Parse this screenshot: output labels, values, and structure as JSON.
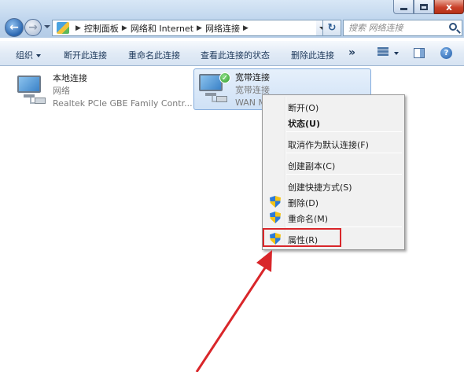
{
  "window": {
    "close_glyph": "x"
  },
  "address_bar": {
    "crumbs": [
      "控制面板",
      "网络和 Internet",
      "网络连接"
    ]
  },
  "search": {
    "placeholder": "搜索 网络连接"
  },
  "toolbar": {
    "organize": "组织",
    "disable": "断开此连接",
    "rename": "重命名此连接",
    "view_status": "查看此连接的状态",
    "delete": "删除此连接",
    "more": "»",
    "help": "?"
  },
  "connections": [
    {
      "name": "本地连接",
      "status": "网络",
      "device": "Realtek PCIe GBE Family Contr..."
    },
    {
      "name": "宽带连接",
      "status": "宽带连接",
      "device": "WAN M"
    }
  ],
  "context_menu": {
    "items": [
      {
        "label": "断开(O)",
        "bold": false,
        "shield": false
      },
      {
        "label": "状态(U)",
        "bold": true,
        "shield": false
      },
      {
        "label": "取消作为默认连接(F)",
        "bold": false,
        "shield": false
      },
      {
        "label": "创建副本(C)",
        "bold": false,
        "shield": false
      },
      {
        "label": "创建快捷方式(S)",
        "bold": false,
        "shield": false
      },
      {
        "label": "删除(D)",
        "bold": false,
        "shield": true
      },
      {
        "label": "重命名(M)",
        "bold": false,
        "shield": true
      },
      {
        "label": "属性(R)",
        "bold": false,
        "shield": true
      }
    ],
    "highlighted_item": "属性(R)"
  },
  "colors": {
    "highlight_box": "#d9262a",
    "arrow": "#d9262a",
    "selection": "#cfe1f6"
  }
}
